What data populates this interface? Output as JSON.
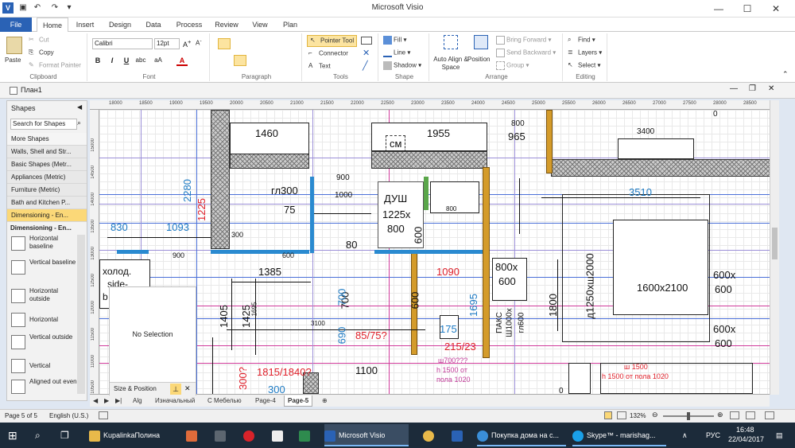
{
  "app": {
    "title": "Microsoft Visio"
  },
  "tabs": [
    "File",
    "Home",
    "Insert",
    "Design",
    "Data",
    "Process",
    "Review",
    "View",
    "Plan"
  ],
  "ribbon": {
    "clipboard": {
      "paste": "Paste",
      "cut": "Cut",
      "copy": "Copy",
      "format_painter": "Format Painter",
      "label": "Clipboard"
    },
    "font": {
      "name": "Calibri",
      "size": "12pt",
      "label": "Font"
    },
    "paragraph": {
      "label": "Paragraph"
    },
    "tools": {
      "pointer": "Pointer Tool",
      "connector": "Connector",
      "text": "Text",
      "label": "Tools"
    },
    "shape": {
      "fill": "Fill",
      "line": "Line",
      "shadow": "Shadow",
      "label": "Shape"
    },
    "arrange": {
      "auto_align": "Auto Align & Space",
      "position": "Position",
      "bring_forward": "Bring Forward",
      "send_backward": "Send Backward",
      "group": "Group",
      "label": "Arrange"
    },
    "editing": {
      "find": "Find",
      "layers": "Layers",
      "select": "Select",
      "label": "Editing"
    }
  },
  "document": {
    "title": "План1"
  },
  "shapes_panel": {
    "title": "Shapes",
    "search_placeholder": "Search for Shapes",
    "categories": [
      "More Shapes",
      "Walls, Shell and Str...",
      "Basic Shapes (Metr...",
      "Appliances (Metric)",
      "Furniture (Metric)",
      "Bath and Kitchen P...",
      "Dimensioning - En..."
    ],
    "stencil_header": "Dimensioning - En...",
    "stencils": [
      "Horizontal baseline",
      "Vertical baseline",
      "Horizontal outside",
      "Horizontal",
      "Vertical outside",
      "Vertical",
      "Aligned out even"
    ]
  },
  "ruler_h": [
    "18000",
    "18500",
    "19000",
    "19500",
    "20000",
    "20500",
    "21000",
    "21500",
    "22000",
    "22500",
    "23000",
    "23500",
    "24000",
    "24500",
    "25000",
    "25500",
    "26000",
    "26500",
    "27000",
    "27500",
    "28000",
    "28500"
  ],
  "ruler_v": [
    "15000",
    "14500",
    "14000",
    "13500",
    "13000",
    "12500",
    "12000",
    "11500",
    "11000",
    "10500"
  ],
  "drawing": {
    "labels_black": [
      "1460",
      "см",
      "1955",
      "965",
      "800",
      "3400",
      "гл300",
      "900",
      "1000",
      "ДУШ",
      "1225х",
      "800",
      "75",
      "80",
      "900",
      "600",
      "800х",
      "600",
      "1385",
      "1405",
      "1425",
      "1695",
      "3100",
      "700",
      "1600х2100",
      "д1250хш2000",
      "1800",
      "600х",
      "600",
      "600х",
      "600",
      "1100",
      "600",
      "ПАКС",
      "Ш1000х",
      "гл600",
      "холод.",
      "side-",
      "b",
      "300",
      "0",
      "0",
      "800"
    ],
    "labels_blue": [
      "2280",
      "830",
      "1093",
      "3510",
      "175",
      "1695",
      "300",
      "690",
      "700",
      "600"
    ],
    "labels_red": [
      "1225",
      "1090",
      "85/75?",
      "215/23",
      "1815/1840?",
      "300?",
      "ш 1500",
      "h 1500 от пола 1020"
    ],
    "labels_pink": [
      "ш700???",
      "h 1500 от",
      "пола 1020"
    ]
  },
  "size_position": {
    "text": "No Selection",
    "title": "Size & Position"
  },
  "sheets": [
    "Alg",
    "Изначальный",
    "С Мебелью",
    "Page-4",
    "Page-5"
  ],
  "status": {
    "page": "Page 5 of 5",
    "language": "English (U.S.)",
    "zoom": "132%"
  },
  "taskbar": {
    "items": [
      "KupalinkaПолина",
      "Microsoft Visio",
      "Покупка дома на с...",
      "Skype™ - marishag..."
    ],
    "lang": "РУС",
    "time": "16:48",
    "date": "22/04/2017"
  }
}
